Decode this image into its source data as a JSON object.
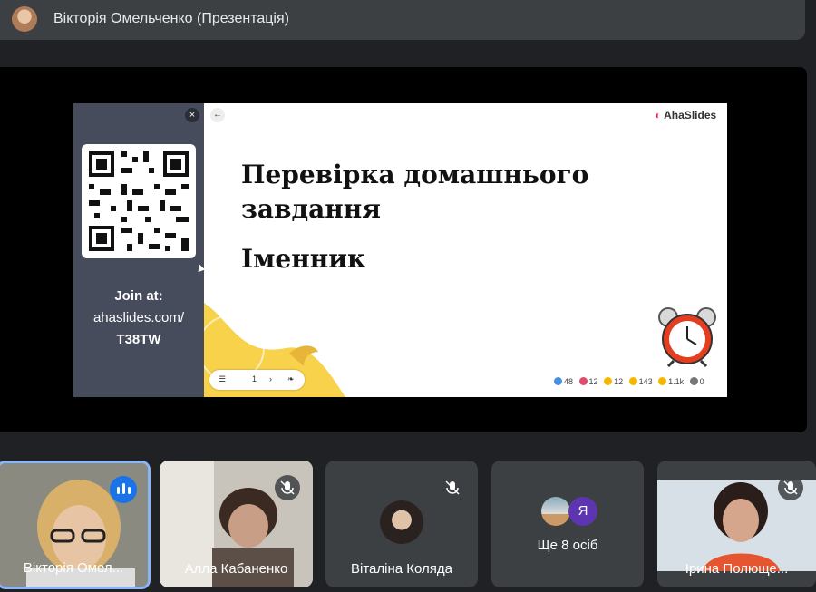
{
  "header": {
    "presenter_title": "Вікторія Омельченко (Презентація)"
  },
  "slide": {
    "close_label": "×",
    "back_label": "←",
    "brand": "AhaSlides",
    "join": {
      "line1": "Join at:",
      "line2": "ahaslides.com/",
      "line3": "T38TW"
    },
    "heading": "Перевірка домашнього завдання",
    "subheading": "Іменник",
    "controls": {
      "menu": "☰",
      "page": "1",
      "next": "›"
    },
    "reactions": [
      {
        "icon": "like-icon",
        "count": "48",
        "color": "#4a90e2"
      },
      {
        "icon": "heart-icon",
        "count": "12",
        "color": "#e24a6a"
      },
      {
        "icon": "laugh-icon",
        "count": "12",
        "color": "#f5b800"
      },
      {
        "icon": "wow-icon",
        "count": "143",
        "color": "#f5b800"
      },
      {
        "icon": "sad-icon",
        "count": "1.1k",
        "color": "#f5b800"
      },
      {
        "icon": "people-icon",
        "count": "0",
        "color": "#777777"
      }
    ]
  },
  "participants": [
    {
      "name": "Вікторія Омел...",
      "state": "speaking"
    },
    {
      "name": "Алла Кабаненко",
      "state": "muted"
    },
    {
      "name": "Віталіна Коляда",
      "state": "muted"
    },
    {
      "name": "Ще 8 осіб",
      "avatar_letter": "Я"
    },
    {
      "name": "Ірина Полющенко",
      "display": "Ірина Полюще...",
      "state": "muted"
    }
  ],
  "colors": {
    "speaking": "#1a73e8",
    "tile_bg": "#3c4043",
    "slide_panel": "#474c5c",
    "accent_yellow": "#f7d24a"
  }
}
